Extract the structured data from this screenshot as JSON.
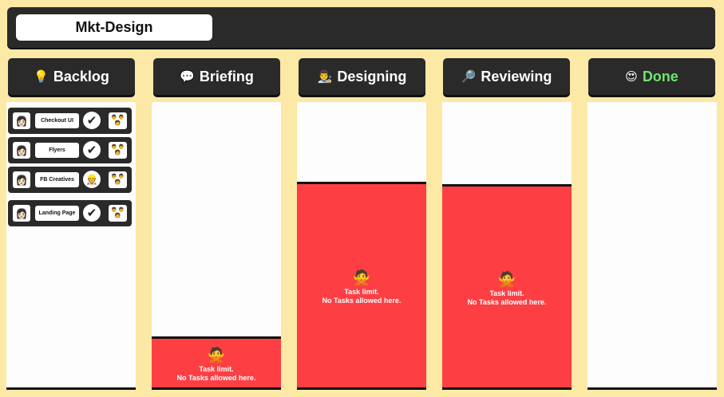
{
  "project": {
    "title": "Mkt-Design"
  },
  "columns": [
    {
      "icon": "💡",
      "icon_name": "lightbulb-icon",
      "label": "Backlog"
    },
    {
      "icon": "💬",
      "icon_name": "speech-bubble-icon",
      "label": "Briefing",
      "limit_emoji": "🙅",
      "limit_line1": "Task limit.",
      "limit_line2": "No Tasks allowed here."
    },
    {
      "icon": "👨‍🎨",
      "icon_name": "artist-icon",
      "label": "Designing",
      "limit_emoji": "🙅",
      "limit_line1": "Task limit.",
      "limit_line2": "No Tasks allowed here."
    },
    {
      "icon": "🔎",
      "icon_name": "magnifier-icon",
      "label": "Reviewing",
      "limit_emoji": "🙅",
      "limit_line1": "Task limit.",
      "limit_line2": "No Tasks allowed here."
    },
    {
      "icon": "😍",
      "icon_name": "heart-eyes-icon",
      "label": "Done",
      "label_color": "#6ee46e"
    }
  ],
  "tasks": [
    {
      "avatar": "👩🏻",
      "name": "Checkout UI",
      "badge": "✔",
      "badge_name": "check-icon",
      "team": "👨 👨\n🧑"
    },
    {
      "avatar": "👩🏻",
      "name": "Flyers",
      "badge": "✔",
      "badge_name": "check-icon",
      "team": "👨 👨\n🧑"
    },
    {
      "avatar": "👩🏻",
      "name": "FB Creatives",
      "badge": "👷",
      "badge_name": "worker-icon",
      "team": "👨 👨\n🧑"
    },
    {
      "avatar": "👩🏻",
      "name": "Landing Page",
      "badge": "✔",
      "badge_name": "check-icon",
      "team": "👨 👨\n🧑"
    }
  ],
  "colors": {
    "background": "#fce9a6",
    "dark": "#2a2a2a",
    "limit_red": "#fd3f44",
    "done_green": "#6ee46e"
  }
}
